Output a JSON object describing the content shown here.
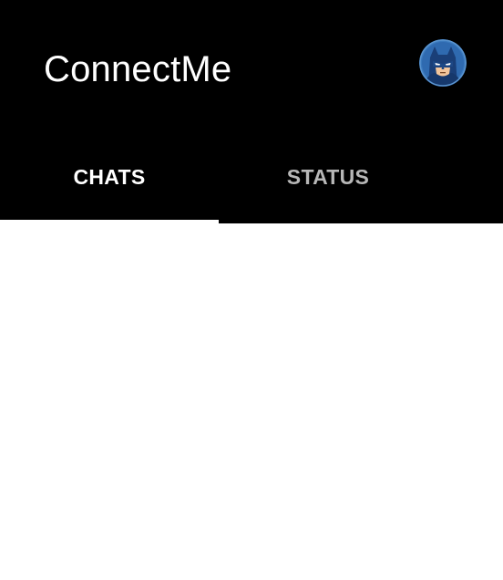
{
  "app_bar": {
    "title": "ConnectMe",
    "background_color": "#000000",
    "title_color": "#ffffff",
    "profile_avatar": {
      "icon": "batman-avatar-icon",
      "background_color": "#2e6fb5"
    }
  },
  "tabs": [
    {
      "label": "CHATS",
      "selected": true,
      "color": "#ffffff"
    },
    {
      "label": "STATUS",
      "selected": false,
      "color": "#b7b7b7"
    }
  ],
  "tab_indicator_color": "#ffffff",
  "content": {
    "background_color": "#ffffff"
  }
}
